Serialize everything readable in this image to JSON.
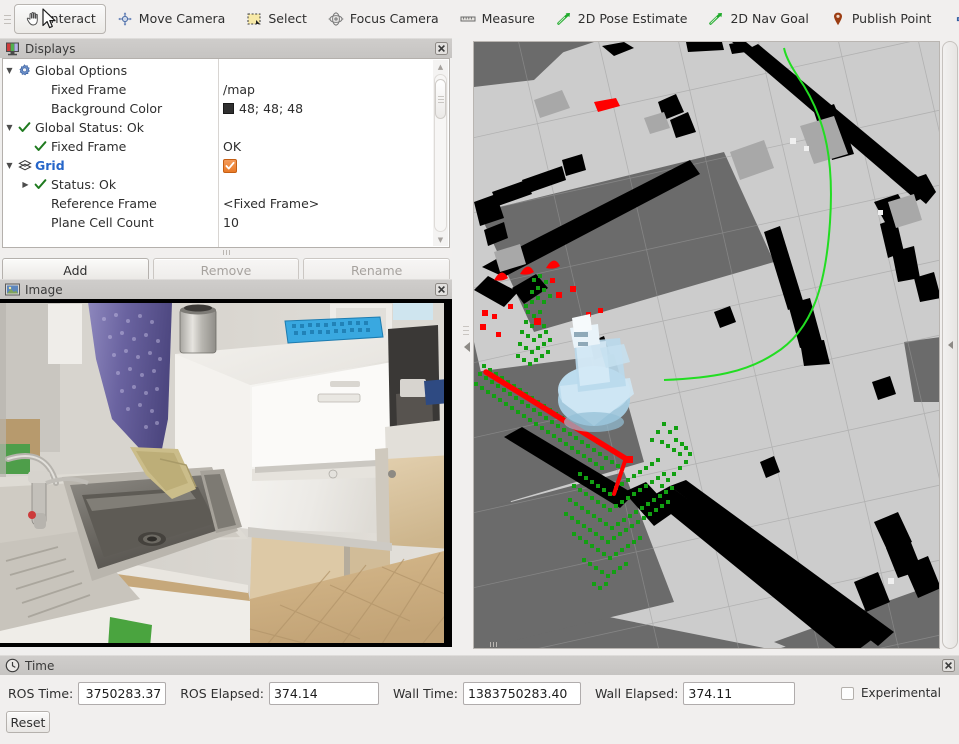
{
  "toolbar": {
    "tools": [
      {
        "label": "Interact",
        "icon": "hand-icon",
        "active": true
      },
      {
        "label": "Move Camera",
        "icon": "move-camera-icon",
        "active": false
      },
      {
        "label": "Select",
        "icon": "select-icon",
        "active": false
      },
      {
        "label": "Focus Camera",
        "icon": "focus-camera-icon",
        "active": false
      },
      {
        "label": "Measure",
        "icon": "measure-ruler-icon",
        "active": false
      },
      {
        "label": "2D Pose Estimate",
        "icon": "pose-estimate-arrow-icon",
        "active": false
      },
      {
        "label": "2D Nav Goal",
        "icon": "nav-goal-arrow-icon",
        "active": false
      },
      {
        "label": "Publish Point",
        "icon": "map-pin-icon",
        "active": false
      }
    ],
    "add_tool_icon": "plus-icon",
    "remove_tool_icon": "minus-icon",
    "overflow_icon": "chevron-down-icon"
  },
  "displays_panel": {
    "title": "Displays",
    "icon": "monitor-icon",
    "close_icon": "close-icon",
    "rows": [
      {
        "indent": 0,
        "twist": "down",
        "icon": "gear-icon",
        "name": "Global Options",
        "value": "",
        "value_type": "none",
        "bold": false,
        "link": false
      },
      {
        "indent": 1,
        "twist": "",
        "icon": "",
        "name": "Fixed Frame",
        "value": "/map",
        "value_type": "text",
        "bold": false,
        "link": false
      },
      {
        "indent": 1,
        "twist": "",
        "icon": "",
        "name": "Background Color",
        "value": "48; 48; 48",
        "value_type": "color",
        "bold": false,
        "link": false
      },
      {
        "indent": 0,
        "twist": "down",
        "icon": "check-icon",
        "name": "Global Status: Ok",
        "value": "",
        "value_type": "none",
        "bold": false,
        "link": false
      },
      {
        "indent": 1,
        "twist": "",
        "icon": "check-icon",
        "name": "Fixed Frame",
        "value": "OK",
        "value_type": "text",
        "bold": false,
        "link": false
      },
      {
        "indent": 0,
        "twist": "down",
        "icon": "grid-icon",
        "name": "Grid",
        "value": "",
        "value_type": "checkbox",
        "bold": true,
        "link": true
      },
      {
        "indent": 1,
        "twist": "right",
        "icon": "check-icon",
        "name": "Status: Ok",
        "value": "",
        "value_type": "none",
        "bold": false,
        "link": false
      },
      {
        "indent": 1,
        "twist": "",
        "icon": "",
        "name": "Reference Frame",
        "value": "<Fixed Frame>",
        "value_type": "text",
        "bold": false,
        "link": false
      },
      {
        "indent": 1,
        "twist": "",
        "icon": "",
        "name": "Plane Cell Count",
        "value": "10",
        "value_type": "text",
        "bold": false,
        "link": false
      }
    ],
    "background_color_hex": "#303030",
    "checkbox_color_hex": "#e97a28",
    "buttons": {
      "add": "Add",
      "remove": "Remove",
      "rename": "Rename"
    }
  },
  "image_panel": {
    "title": "Image",
    "icon": "image-icon",
    "close_icon": "close-icon",
    "scene_description": "Kitchen camera view: stainless steel sink with faucet, white dishwasher, wooden cabinets, parquet floor, blue pipette tray and metal canister on counter, purple patterned curtain"
  },
  "view3d": {
    "map_unknown_color": "#6b6b6b",
    "map_free_color": "#cccccc",
    "map_occupied_color": "#000000",
    "obstacle_cloud_color": "#12a012",
    "laser_scan_color": "#ff0000",
    "path_color": "#22dd22",
    "robot_color": "#a8cfe4",
    "grid_line_color": "#9b9b9b",
    "collapse_icon": "collapse-left-icon"
  },
  "time_panel": {
    "title": "Time",
    "icon": "clock-icon",
    "close_icon": "close-icon",
    "fields": [
      {
        "label": "ROS Time:",
        "value": "3750283.37"
      },
      {
        "label": "ROS Elapsed:",
        "value": "374.14"
      },
      {
        "label": "Wall Time:",
        "value": "1383750283.40"
      },
      {
        "label": "Wall Elapsed:",
        "value": "374.11"
      }
    ],
    "experimental_label": "Experimental",
    "experimental_checked": false,
    "reset_label": "Reset"
  }
}
